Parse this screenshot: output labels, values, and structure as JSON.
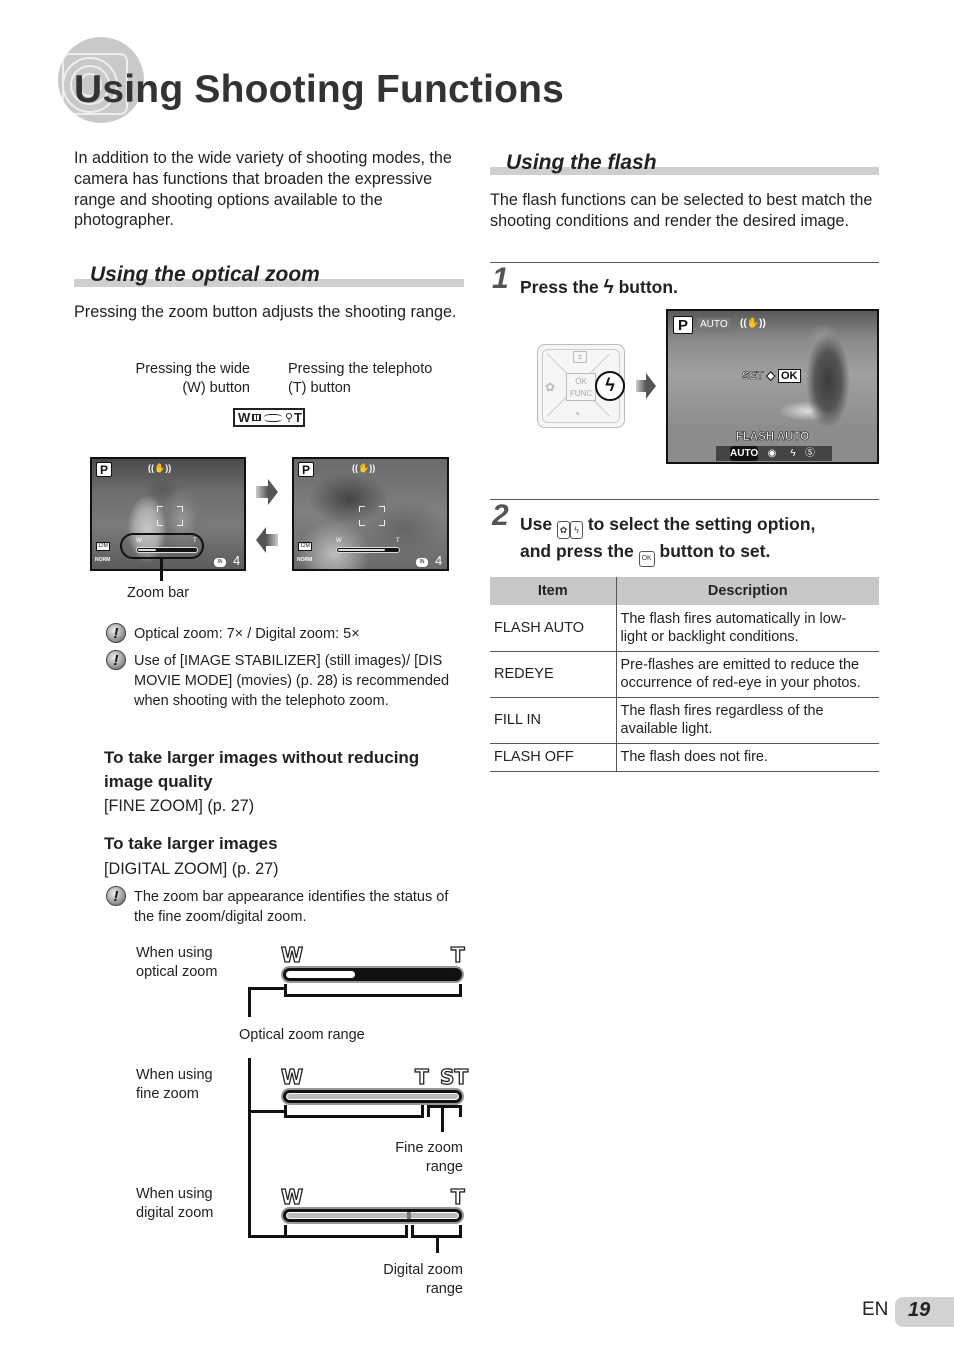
{
  "page": {
    "title": "Using Shooting Functions",
    "intro": "In addition to the wide variety of shooting modes, the camera has functions that broaden the expressive range and shooting options available to the photographer.",
    "language": "EN",
    "page_number": "19"
  },
  "optical_zoom": {
    "heading": "Using the optical zoom",
    "description": "Pressing the zoom button adjusts the shooting range.",
    "wide_label_line1": "Pressing the wide",
    "wide_label_line2": "(W) button",
    "tele_label_line1": "Pressing the telephoto",
    "tele_label_line2": "(T) button",
    "lever_icon": {
      "w": "W",
      "t": "T",
      "name": "zoom-lever-icon"
    },
    "screens": [
      {
        "mode": "P",
        "stabilizer": "((✋))",
        "image_size": "12M",
        "quality": "NORM",
        "memory": "IN",
        "shots_remaining": "4",
        "zoom_w": "W",
        "zoom_t": "T",
        "zoom_position": 0.3
      },
      {
        "mode": "P",
        "stabilizer": "((✋))",
        "image_size": "12M",
        "quality": "NORM",
        "memory": "IN",
        "shots_remaining": "4",
        "zoom_w": "W",
        "zoom_t": "T",
        "zoom_position": 0.75
      }
    ],
    "zoom_bar_callout": "Zoom bar",
    "notes": [
      "Optical zoom: 7× / Digital zoom: 5×",
      "Use of [IMAGE STABILIZER] (still images)/ [DIS MOVIE MODE] (movies) (p. 28) is recommended when shooting with the telephoto zoom."
    ],
    "note_line2": [
      "[DIS MOVIE MODE] (movies) (p. 28) is",
      "recommended when shooting with the",
      "telephoto zoom."
    ],
    "fine_zoom": {
      "heading_line1": "To take larger images without reducing",
      "heading_line2": "image quality",
      "ref": "[FINE ZOOM] (p. 27)"
    },
    "digital_zoom": {
      "heading": "To take larger images",
      "ref": "[DIGITAL ZOOM] (p. 27)"
    },
    "zoom_status_note": "The zoom bar appearance identifies the status of the fine zoom/digital zoom.",
    "zoom_bars": {
      "optical": {
        "label_line1": "When using",
        "label_line2": "optical zoom",
        "left": "W",
        "right": "T",
        "fill": 0.4,
        "range_label": "Optical zoom range"
      },
      "fine": {
        "label_line1": "When using",
        "label_line2": "fine zoom",
        "left": "W",
        "mid": "T",
        "right": "ST",
        "range_label_line1": "Fine zoom",
        "range_label_line2": "range"
      },
      "digital": {
        "label_line1": "When using",
        "label_line2": "digital zoom",
        "left": "W",
        "right": "T",
        "range_label_line1": "Digital zoom",
        "range_label_line2": "range"
      }
    }
  },
  "flash": {
    "heading": "Using the flash",
    "description": "The flash functions can be selected to best match the shooting conditions and render the desired image.",
    "step1": {
      "number": "1",
      "text_before": "Press the",
      "icon": "⚡",
      "text_after": "button."
    },
    "dpad": {
      "ok_line1": "OK",
      "ok_line2": "FUNC",
      "ev": "±",
      "macro": "✿",
      "timer": "◔",
      "flash": "ϟ"
    },
    "screen": {
      "mode": "P",
      "auto_tag": "AUTO",
      "stabilizer": "((✋))",
      "set_text": "SET",
      "ok_text": "OK",
      "menu_label": "FLASH AUTO",
      "options": [
        "AUTO",
        "◉",
        "ϟ",
        "Ⓢ"
      ],
      "selected_option": "AUTO"
    },
    "step2": {
      "number": "2",
      "line1_before": "Use",
      "line1_after": "to select the setting option,",
      "line2_before": "and press the",
      "line2_after": "button to set.",
      "icon_left": "✿",
      "icon_right": "ϟ",
      "ok_icon": "OK"
    },
    "table": {
      "headers": [
        "Item",
        "Description"
      ],
      "rows": [
        {
          "item": "FLASH AUTO",
          "desc_line1": "The flash fires automatically in low-",
          "desc_line2": "light or backlight conditions."
        },
        {
          "item": "REDEYE",
          "desc_line1": "Pre-flashes are emitted to reduce the",
          "desc_line2": "occurrence of red-eye in your photos."
        },
        {
          "item": "FILL IN",
          "desc_line1": "The flash fires regardless of the",
          "desc_line2": "available light."
        },
        {
          "item": "FLASH OFF",
          "desc_line1": "The flash does not fire.",
          "desc_line2": ""
        }
      ]
    }
  }
}
